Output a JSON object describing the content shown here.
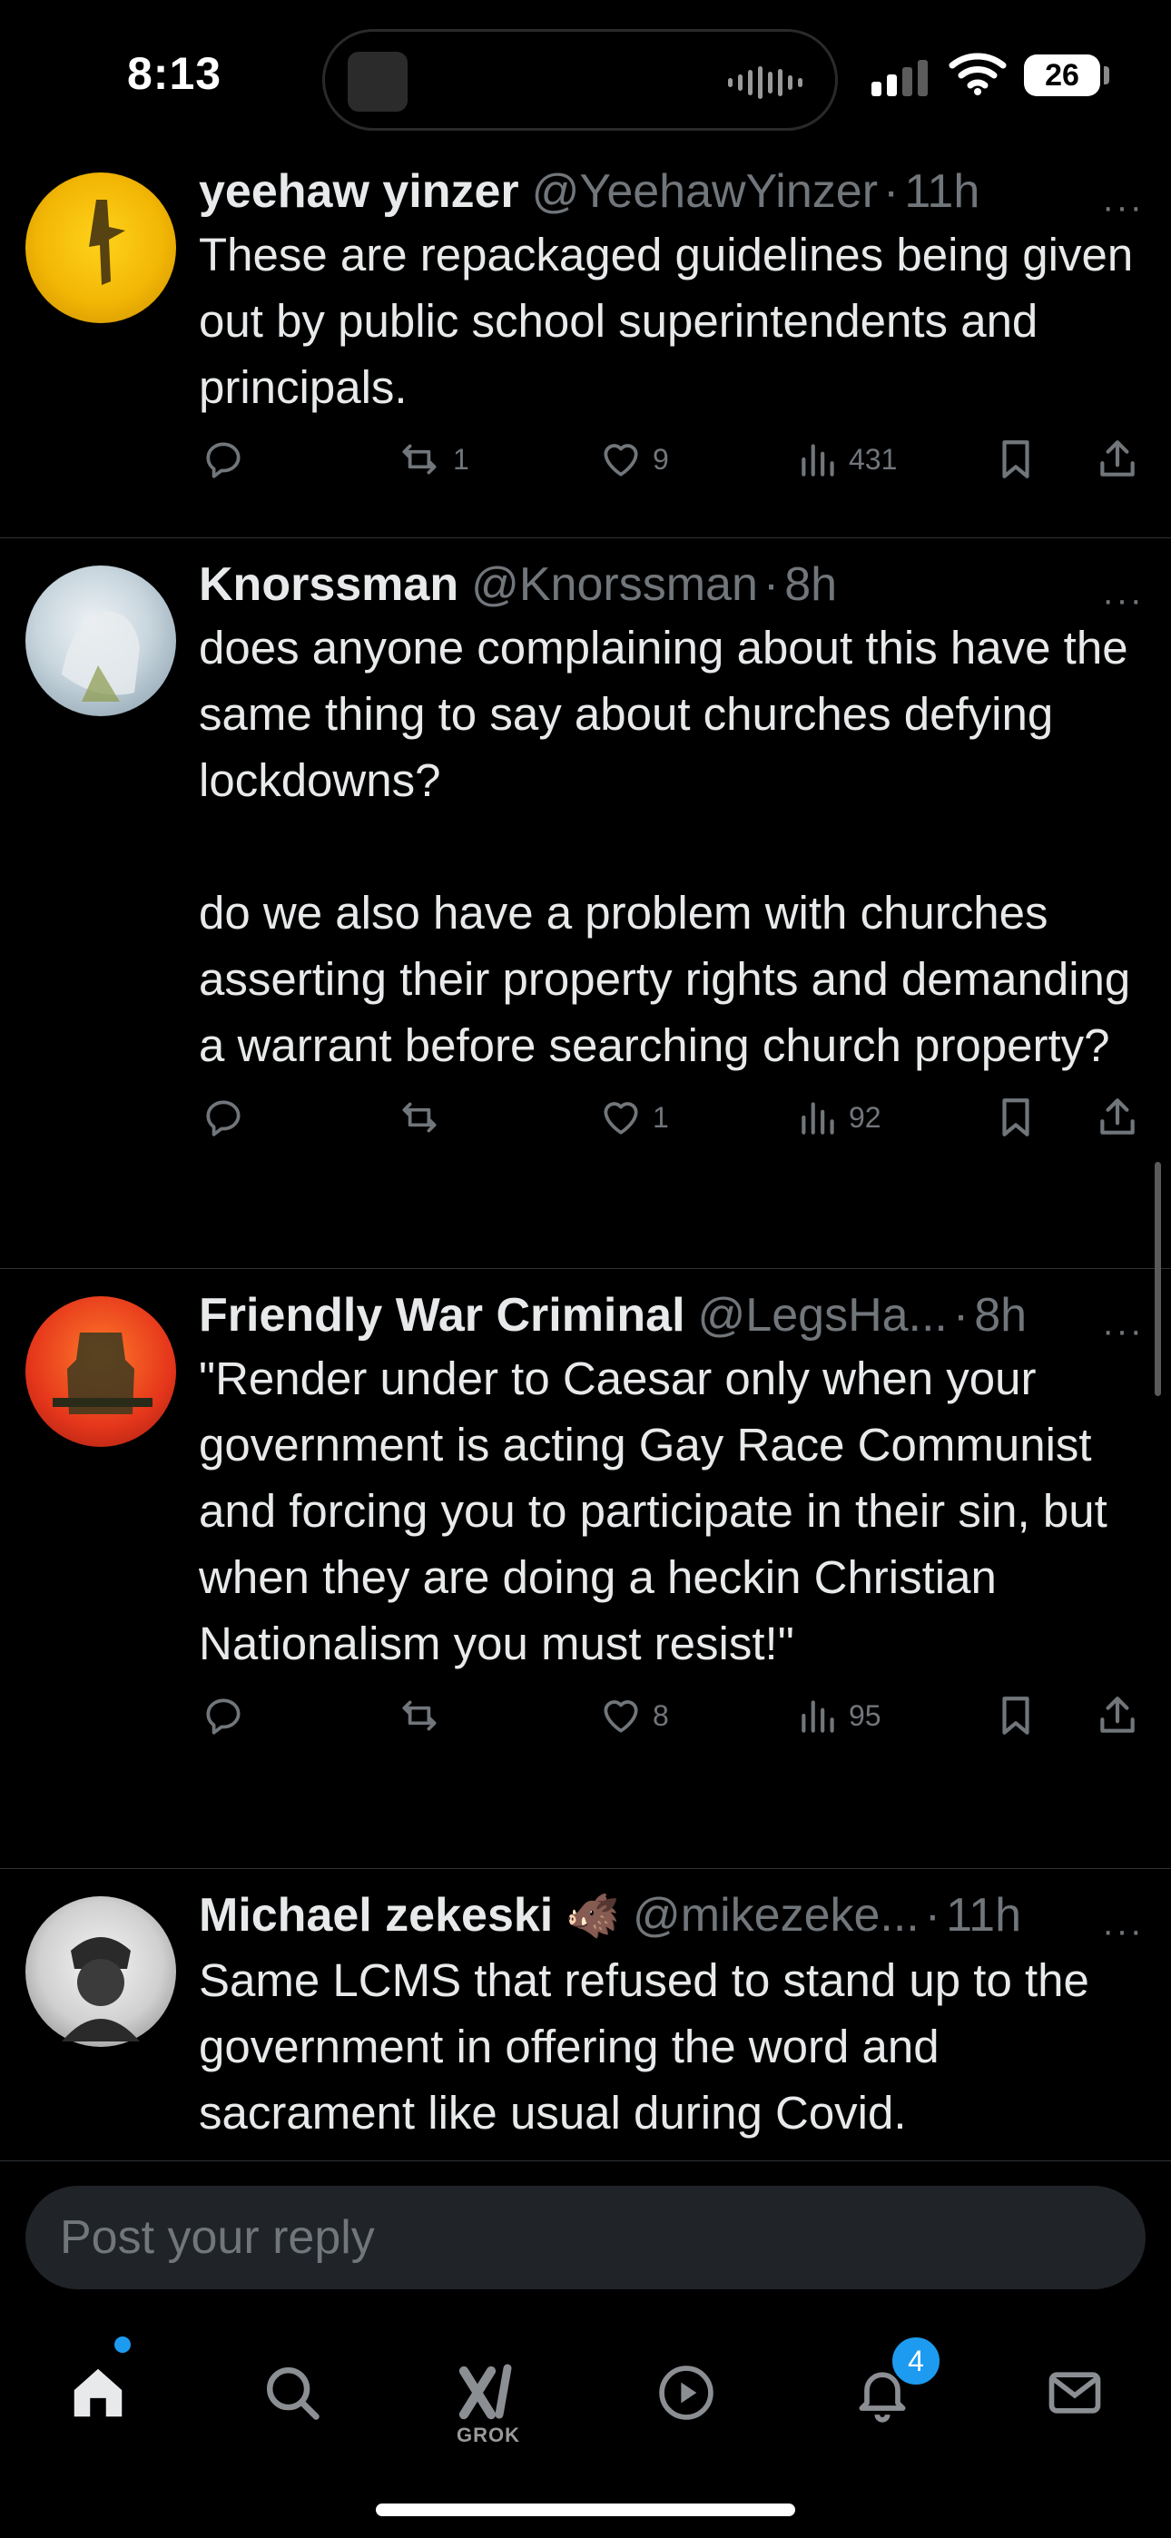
{
  "status_bar": {
    "time": "8:13",
    "battery": "26"
  },
  "tweets": [
    {
      "name": "yeehaw yinzer",
      "handle": "@YeehawYinzer",
      "age": "11h",
      "text": "These are repackaged guidelines being given out by public school superintendents and principals.",
      "retweets": "1",
      "likes": "9",
      "views": "431"
    },
    {
      "name": "Knorssman",
      "handle": "@Knorssman",
      "age": "8h",
      "text": "does anyone complaining about this have the same thing to say about churches defying lockdowns?\n\ndo we also have a problem with churches asserting their property rights and demanding a warrant before searching church property?",
      "retweets": "",
      "likes": "1",
      "views": "92"
    },
    {
      "name": "Friendly War Criminal",
      "handle": "@LegsHa...",
      "age": "8h",
      "text": "\"Render under to Caesar only when your government is acting Gay Race Communist and forcing you to participate in their sin, but when they are doing a heckin Christian Nationalism you must resist!\"",
      "retweets": "",
      "likes": "8",
      "views": "95"
    },
    {
      "name": "Michael zekeski",
      "name_emoji": "🐗",
      "handle": "@mikezeke...",
      "age": "11h",
      "text": "Same LCMS that refused to stand up to the government in offering the word and sacrament like usual during Covid."
    }
  ],
  "separator": "·",
  "more_glyph": "···",
  "reply": {
    "placeholder": "Post your reply"
  },
  "tabbar": {
    "grok_label": "GROK",
    "notifications_badge": "4"
  },
  "colors": {
    "accent": "#1d9bf0",
    "muted": "#71767b",
    "text": "#e7e9ea",
    "background": "#000000"
  }
}
